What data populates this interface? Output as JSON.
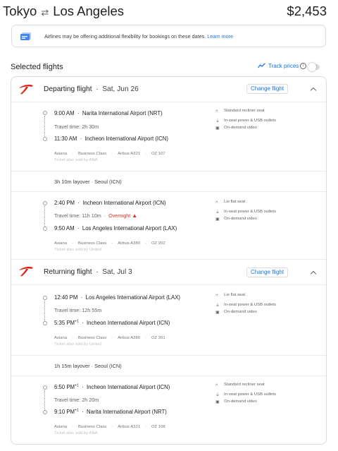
{
  "header": {
    "origin": "Tokyo",
    "swap_icon": "swap-arrows-icon",
    "destination": "Los Angeles",
    "price": "$2,453"
  },
  "notice": {
    "icon": "ticket-icon",
    "text": "Airlines may be offering additional flexibility for bookings on these dates.",
    "link": "Learn more"
  },
  "selected": {
    "title": "Selected flights",
    "track_label": "Track prices",
    "track_icon": "trend-line-icon",
    "info_icon": "info-icon"
  },
  "trips": [
    {
      "title": "Departing flight",
      "date": "Sat, Jun 26",
      "change_label": "Change flight",
      "airline_logo_color": "#e2231a",
      "segments": [
        {
          "dep_time": "9:00 AM",
          "dep_airport": "Narita International Airport (NRT)",
          "travel_time": "Travel time: 2h 30m",
          "arr_time": "11:30 AM",
          "arr_airport": "Incheon International Airport (ICN)",
          "airline": "Asiana",
          "class": "Business Class",
          "aircraft": "Airbus A321",
          "flight_no": "OZ 107",
          "sold_by": "Ticket also sold by ANA",
          "amenities": [
            "Standard recliner seat",
            "In-seat power & USB outlets",
            "On-demand video"
          ]
        },
        {
          "dep_time": "2:40 PM",
          "dep_airport": "Incheon International Airport (ICN)",
          "travel_time": "Travel time: 11h 10m",
          "overnight": "Overnight",
          "arr_time": "9:50 AM",
          "arr_airport": "Los Angeles International Airport (LAX)",
          "airline": "Asiana",
          "class": "Business Class",
          "aircraft": "Airbus A380",
          "flight_no": "OZ 202",
          "sold_by": "Ticket also sold by United",
          "amenities": [
            "Lie flat seat",
            "In-seat power & USB outlets",
            "On-demand video"
          ]
        }
      ],
      "layover": "3h 10m layover · Seoul (ICN)"
    },
    {
      "title": "Returning flight",
      "date": "Sat, Jul 3",
      "change_label": "Change flight",
      "airline_logo_color": "#e2231a",
      "segments": [
        {
          "dep_time": "12:40 PM",
          "dep_airport": "Los Angeles International Airport (LAX)",
          "travel_time": "Travel time: 12h 55m",
          "arr_time": "5:35 PM",
          "arr_sup": "+1",
          "arr_airport": "Incheon International Airport (ICN)",
          "airline": "Asiana",
          "class": "Business Class",
          "aircraft": "Airbus A380",
          "flight_no": "OZ 201",
          "sold_by": "Ticket also sold by United",
          "amenities": [
            "Lie flat seat",
            "In-seat power & USB outlets",
            "On-demand video"
          ]
        },
        {
          "dep_time": "6:50 PM",
          "dep_sup": "+1",
          "dep_airport": "Incheon International Airport (ICN)",
          "travel_time": "Travel time: 2h 20m",
          "arr_time": "9:10 PM",
          "arr_sup": "+1",
          "arr_airport": "Narita International Airport (NRT)",
          "airline": "Asiana",
          "class": "Business Class",
          "aircraft": "Airbus A321",
          "flight_no": "OZ 108",
          "sold_by": "Ticket also sold by ANA",
          "amenities": [
            "Standard recliner seat",
            "In-seat power & USB outlets",
            "On-demand video"
          ]
        }
      ],
      "layover": "1h 15m layover · Seoul (ICN)"
    }
  ]
}
